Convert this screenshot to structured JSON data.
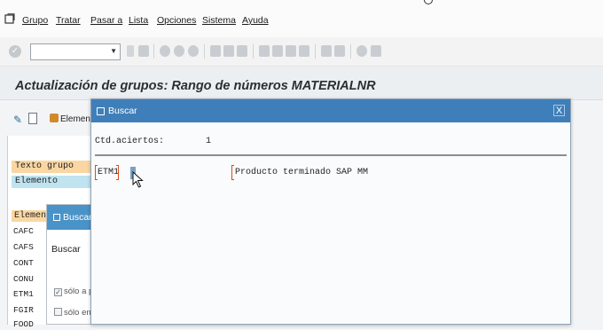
{
  "menu": {
    "items": [
      "Grupo",
      "Tratar",
      "Pasar a",
      "Lista",
      "Opciones",
      "Sistema",
      "Ayuda"
    ]
  },
  "page": {
    "title": "Actualización de grupos: Rango de números MATERIALNR"
  },
  "app_toolbar": {
    "elements_label": "Element"
  },
  "background_panel": {
    "group_text_label": "Texto grupo",
    "element_label": "Elemento",
    "list_header": "Elemento",
    "rows": [
      "CAFC",
      "CAFS",
      "CONT",
      "CONU",
      "ETM1",
      "FGIR",
      "FOOD"
    ]
  },
  "small_dialog": {
    "title": "Buscar",
    "search_label": "Buscar",
    "option1": "sólo a p",
    "option2": "sólo en"
  },
  "search_dialog": {
    "title": "Buscar",
    "close_glyph": "X",
    "hits_label": "Ctd.aciertos:",
    "hits_count": "1",
    "result": {
      "key": "ETM1",
      "description": "Producto terminado SAP MM"
    }
  },
  "colors": {
    "dialog_header": "#3f7fb9",
    "highlight_orange": "#fad7a2",
    "highlight_blue": "#bfe3ef",
    "bracket_red": "#d84a1c"
  }
}
